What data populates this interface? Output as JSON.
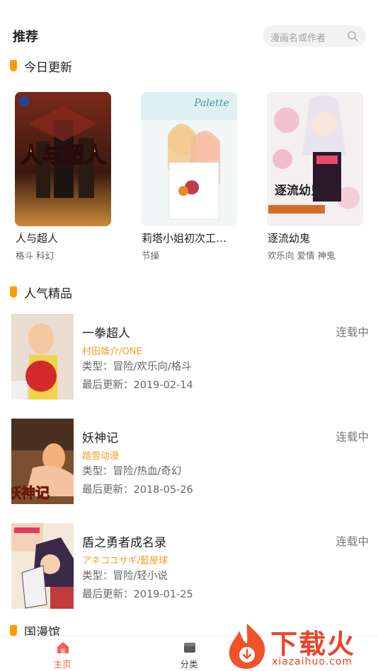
{
  "header": {
    "title": "推荐",
    "search_placeholder": "漫画名或作者"
  },
  "sections": {
    "today": "今日更新",
    "popular": "人气精品",
    "domestic": "国漫馆"
  },
  "today_cards": [
    {
      "title": "人与超人",
      "tags": "格斗 科幻",
      "cover_text": "人与超人"
    },
    {
      "title": "莉塔小姐初次工…",
      "tags": "节操",
      "cover_text": "Palette"
    },
    {
      "title": "逐流幼鬼",
      "tags": "欢乐向 爱情 神鬼",
      "cover_text": "逐流幼鬼"
    }
  ],
  "popular_list": [
    {
      "name": "一拳超人",
      "author": "村田雄介/ONE",
      "genre": "类型：冒险/欢乐向/格斗",
      "updated": "最后更新：2019-02-14",
      "status": "连载中"
    },
    {
      "name": "妖神记",
      "author": "踏雪动漫",
      "genre": "类型：冒险/热血/奇幻",
      "updated": "最后更新：2018-05-26",
      "status": "连载中",
      "cover_text": "妖神记"
    },
    {
      "name": "盾之勇者成名录",
      "author": "アネコユサギ/藍屋球",
      "genre": "类型：冒险/轻小说",
      "updated": "最后更新：2019-01-25",
      "status": "连载中"
    }
  ],
  "tabbar": {
    "home": "主页",
    "category": "分类",
    "active_color": "#ff5a4a"
  },
  "watermark": {
    "text": "下载火",
    "url": "xiazaihuo.com"
  }
}
